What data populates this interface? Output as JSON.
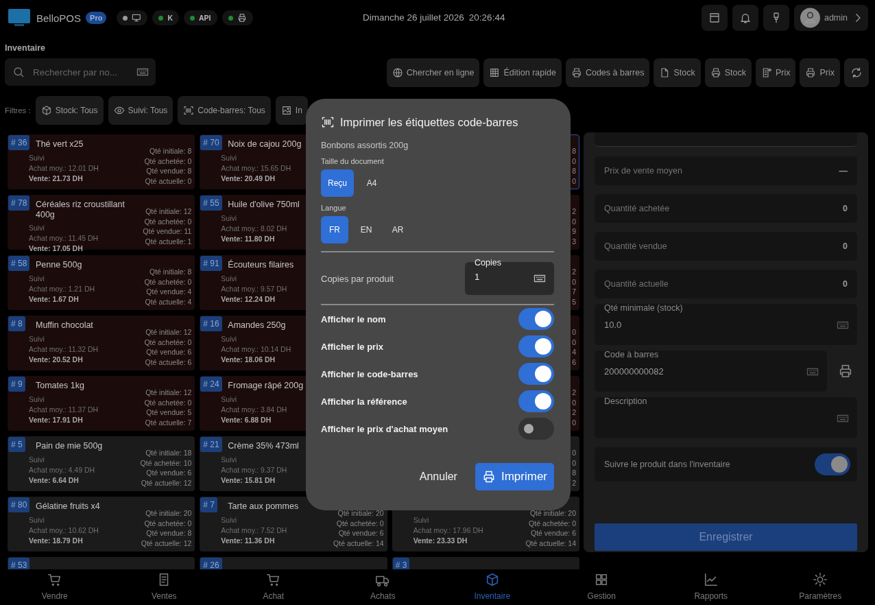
{
  "app": {
    "name": "BelloPOS",
    "badge": "Pro"
  },
  "status_pills": [
    {
      "kind": "screen",
      "color": "#9a9a9a"
    },
    {
      "kind": "text",
      "label": "K",
      "color": "#1f8a35"
    },
    {
      "kind": "text",
      "label": "API",
      "color": "#1f8a35"
    },
    {
      "kind": "printer",
      "color": "#1f8a35"
    }
  ],
  "date": "Dimanche 26 juillet 2026",
  "time": "20:26:44",
  "user": {
    "name": "admin"
  },
  "page_title": "Inventaire",
  "search": {
    "placeholder": "Rechercher par no..."
  },
  "toolbar": [
    "Chercher en ligne",
    "Édition rapide",
    "Codes à barres",
    "Stock",
    "Stock",
    "Prix",
    "Prix"
  ],
  "filters": {
    "label": "Filtres :",
    "chips": [
      "Stock: Tous",
      "Suivi: Tous",
      "Code-barres: Tous",
      "In"
    ]
  },
  "products": [
    {
      "badge": "# 36",
      "name": "Thé vert x25",
      "tracking": "Suivi",
      "avg_purchase": "Achat moy.: 12.01 DH",
      "sale": "Vente: 21.73 DH",
      "qty": [
        "Qté initiale: 8",
        "Qté achetée: 0",
        "Qté vendue: 8",
        "Qté actuelle: 0"
      ],
      "low_stock": true,
      "selected": false
    },
    {
      "badge": "# 70",
      "name": "Noix de cajou 200g",
      "tracking": "Suivi",
      "avg_purchase": "Achat moy.: 15.65 DH",
      "sale": "Vente: 20.49 DH",
      "low_stock": true,
      "selected": false
    },
    {
      "qty": [
        "8",
        "0",
        "8",
        "0"
      ],
      "low_stock": true,
      "selected": true
    },
    {
      "badge": "# 78",
      "name": "Céréales riz croustillant 400g",
      "tracking": "Suivi",
      "avg_purchase": "Achat moy.: 11.45 DH",
      "sale": "Vente: 17.05 DH",
      "qty": [
        "Qté initiale: 12",
        "Qté achetée: 0",
        "Qté vendue: 11",
        "Qté actuelle: 1"
      ],
      "low_stock": true,
      "selected": false
    },
    {
      "badge": "# 55",
      "name": "Huile d'olive 750ml",
      "tracking": "Suivi",
      "avg_purchase": "Achat moy.: 8.02 DH",
      "sale": "Vente: 11.80 DH",
      "low_stock": true,
      "selected": false
    },
    {
      "qty": [
        "2",
        "0",
        "9",
        "3"
      ],
      "low_stock": true,
      "selected": false
    },
    {
      "badge": "# 58",
      "name": "Penne 500g",
      "tracking": "Suivi",
      "avg_purchase": "Achat moy.: 1.21 DH",
      "sale": "Vente: 1.67 DH",
      "qty": [
        "Qté initiale: 8",
        "Qté achetée: 0",
        "Qté vendue: 4",
        "Qté actuelle: 4"
      ],
      "low_stock": true,
      "selected": false
    },
    {
      "badge": "# 91",
      "name": "Écouteurs filaires",
      "tracking": "Suivi",
      "avg_purchase": "Achat moy.: 9.57 DH",
      "sale": "Vente: 12.24 DH",
      "low_stock": true,
      "selected": false
    },
    {
      "qty": [
        "2",
        "0",
        "7",
        "5"
      ],
      "low_stock": true,
      "selected": false
    },
    {
      "badge": "# 8",
      "name": "Muffin chocolat",
      "tracking": "Suivi",
      "avg_purchase": "Achat moy.: 11.32 DH",
      "sale": "Vente: 20.52 DH",
      "qty": [
        "Qté initiale: 12",
        "Qté achetée: 0",
        "Qté vendue: 6",
        "Qté actuelle: 6"
      ],
      "low_stock": true,
      "selected": false
    },
    {
      "badge": "# 16",
      "name": "Amandes 250g",
      "tracking": "Suivi",
      "avg_purchase": "Achat moy.: 10.14 DH",
      "sale": "Vente: 18.06 DH",
      "low_stock": true,
      "selected": false
    },
    {
      "qty": [
        "0",
        "0",
        "4",
        "6"
      ],
      "low_stock": true,
      "selected": false
    },
    {
      "badge": "# 9",
      "name": "Tomates 1kg",
      "tracking": "Suivi",
      "avg_purchase": "Achat moy.: 11.37 DH",
      "sale": "Vente: 17.91 DH",
      "qty": [
        "Qté initiale: 12",
        "Qté achetée: 0",
        "Qté vendue: 5",
        "Qté actuelle: 7"
      ],
      "low_stock": true,
      "selected": false
    },
    {
      "badge": "# 24",
      "name": "Fromage râpé 200g",
      "tracking": "Suivi",
      "avg_purchase": "Achat moy.: 3.84 DH",
      "sale": "Vente: 6.88 DH",
      "low_stock": true,
      "selected": false
    },
    {
      "qty": [
        "2",
        "0",
        "2",
        "0"
      ],
      "low_stock": true,
      "selected": false
    },
    {
      "badge": "# 5",
      "name": "Pain de mie 500g",
      "tracking": "Suivi",
      "avg_purchase": "Achat moy.: 4.49 DH",
      "sale": "Vente: 6.64 DH",
      "qty": [
        "Qté initiale: 18",
        "Qté achetée: 10",
        "Qté vendue: 6",
        "Qté actuelle: 12"
      ],
      "low_stock": false,
      "selected": false
    },
    {
      "badge": "# 21",
      "name": "Crème 35% 473ml",
      "tracking": "Suivi",
      "avg_purchase": "Achat moy.: 9.37 DH",
      "sale": "Vente: 15.81 DH",
      "low_stock": false,
      "selected": false
    },
    {
      "qty": [
        "0",
        "0",
        "8",
        "2"
      ],
      "low_stock": false,
      "selected": false
    },
    {
      "badge": "# 80",
      "name": "Gélatine fruits x4",
      "tracking": "Suivi",
      "avg_purchase": "Achat moy.: 10.62 DH",
      "sale": "Vente: 18.79 DH",
      "qty": [
        "Qté initiale: 20",
        "Qté achetée: 0",
        "Qté vendue: 8",
        "Qté actuelle: 12"
      ],
      "low_stock": false,
      "selected": false
    },
    {
      "badge": "# 7",
      "name": "Tarte aux pommes",
      "tracking": "Suivi",
      "avg_purchase": "Achat moy.: 7.52 DH",
      "sale": "Vente: 11.36 DH",
      "qty": [
        "Qté initiale: 20",
        "Qté achetée: 0",
        "Qté vendue: 6",
        "Qté actuelle: 14"
      ],
      "low_stock": false,
      "selected": false
    },
    {
      "tracking": "Suivi",
      "avg_purchase": "Achat moy.: 17.96 DH",
      "sale": "Vente: 23.33 DH",
      "qty": [
        "Qté initiale: 20",
        "Qté achetée: 0",
        "Qté vendue: 6",
        "Qté actuelle: 14"
      ],
      "low_stock": false,
      "selected": false
    },
    {
      "badge": "# 53",
      "low_stock": false,
      "selected": false
    },
    {
      "badge": "# 26",
      "low_stock": false,
      "selected": false
    },
    {
      "badge": "# 3",
      "low_stock": false,
      "selected": false
    }
  ],
  "details": {
    "fields": [
      {
        "kind": "stat",
        "label": "Prix de vente moyen",
        "value": "—"
      },
      {
        "kind": "stat",
        "label": "Quantité achetée",
        "value": "0"
      },
      {
        "kind": "stat",
        "label": "Quantité vendue",
        "value": "0"
      },
      {
        "kind": "stat",
        "label": "Quantité actuelle",
        "value": "0"
      },
      {
        "kind": "input",
        "label": "Qté minimale (stock)",
        "value": "10.0"
      },
      {
        "kind": "input",
        "label": "Code à barres",
        "value": "200000000082",
        "print": true
      },
      {
        "kind": "input",
        "label": "Description"
      },
      {
        "kind": "toggle",
        "label": "Suivre le produit dans l'inventaire",
        "on": true
      }
    ],
    "save": "Enregistrer"
  },
  "nav": [
    {
      "label": "Vendre",
      "selected": false
    },
    {
      "label": "Ventes",
      "selected": false
    },
    {
      "label": "Achat",
      "selected": false
    },
    {
      "label": "Achats",
      "selected": false
    },
    {
      "label": "Inventaire",
      "selected": true
    },
    {
      "label": "Gestion",
      "selected": false
    },
    {
      "label": "Rapports",
      "selected": false
    },
    {
      "label": "Paramètres",
      "selected": false
    }
  ],
  "dialog": {
    "title": "Imprimer les étiquettes code-barres",
    "product": "Bonbons assortis 200g",
    "size": {
      "label": "Taille du document",
      "options": [
        {
          "label": "Reçu",
          "selected": true
        },
        {
          "label": "A4",
          "selected": false
        }
      ]
    },
    "language": {
      "label": "Langue",
      "options": [
        {
          "label": "FR",
          "selected": true
        },
        {
          "label": "EN",
          "selected": false
        },
        {
          "label": "AR",
          "selected": false
        }
      ]
    },
    "copies": {
      "label": "Copies par produit",
      "field_label": "Copies",
      "value": "1"
    },
    "options": [
      {
        "label": "Afficher le nom",
        "on": true
      },
      {
        "label": "Afficher le prix",
        "on": true
      },
      {
        "label": "Afficher le code-barres",
        "on": true
      },
      {
        "label": "Afficher la référence",
        "on": true
      },
      {
        "label": "Afficher le prix d'achat moyen",
        "on": false
      }
    ],
    "cancel": "Annuler",
    "confirm": "Imprimer"
  }
}
